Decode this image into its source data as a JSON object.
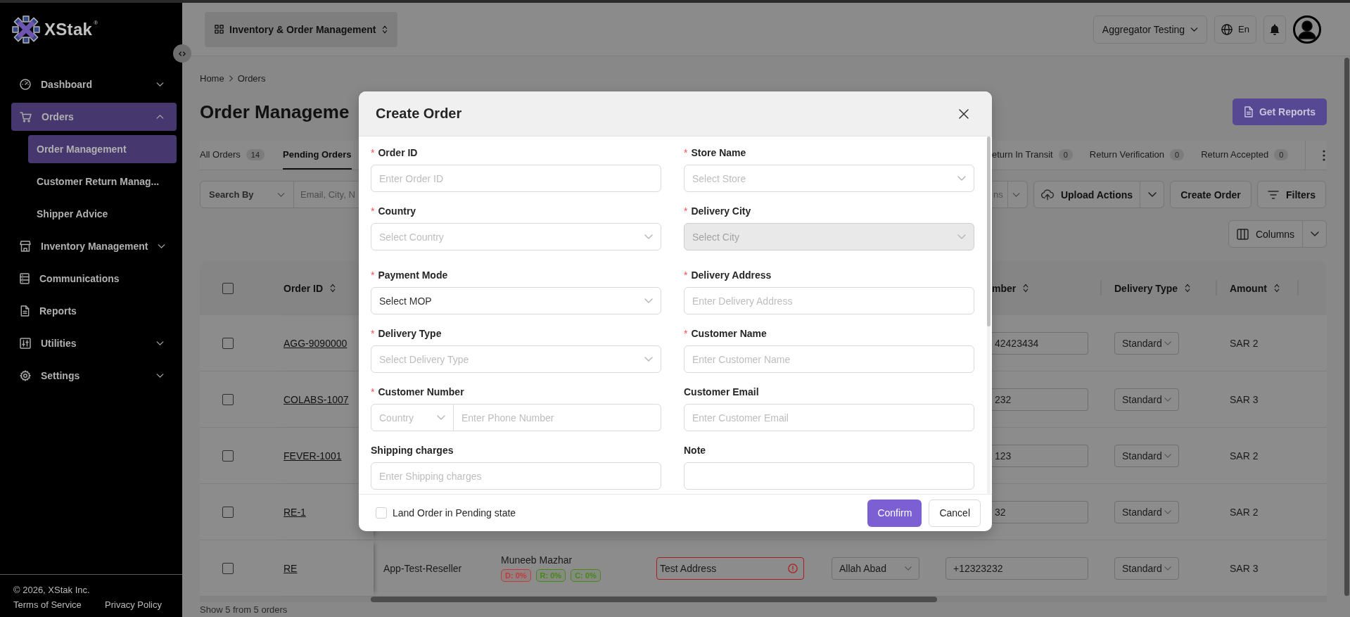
{
  "sidebar": {
    "logo": {
      "name": "XStak",
      "trademark": "®"
    },
    "items": [
      {
        "label": "Dashboard",
        "kind": "group",
        "expanded": false,
        "selected": false
      },
      {
        "label": "Orders",
        "kind": "group",
        "expanded": true,
        "selected": true,
        "children": [
          {
            "label": "Order Management",
            "selected": true
          },
          {
            "label": "Customer Return Manag...",
            "selected": false
          },
          {
            "label": "Shipper Advice",
            "selected": false
          }
        ]
      },
      {
        "label": "Inventory Management",
        "kind": "group",
        "expanded": false,
        "selected": false
      },
      {
        "label": "Communications",
        "kind": "link",
        "selected": false
      },
      {
        "label": "Reports",
        "kind": "link",
        "selected": false
      },
      {
        "label": "Utilities",
        "kind": "group",
        "expanded": false,
        "selected": false
      },
      {
        "label": "Settings",
        "kind": "group",
        "expanded": false,
        "selected": false
      }
    ],
    "footer": {
      "copyright": "© 2026, XStak Inc.",
      "links": [
        "Terms of Service",
        "Privacy Policy"
      ]
    }
  },
  "top_bar": {
    "app_switcher": "Inventory & Order Management",
    "account": "Aggregator Testing",
    "language": "En"
  },
  "page": {
    "breadcrumb": [
      "Home",
      "Orders"
    ],
    "title": "Order Manageme",
    "reports_button": "Get Reports",
    "tabs": [
      {
        "label": "All Orders",
        "count": "14",
        "selected": false
      },
      {
        "label": "Pending Orders",
        "selected": true
      },
      {
        "label": "eturn In Transit",
        "count": "0",
        "selected": false
      },
      {
        "label": "Return Verification",
        "count": "0",
        "selected": false
      },
      {
        "label": "Return Accepted",
        "count": "0",
        "selected": false
      }
    ],
    "toolbar": {
      "search_by": "Search By",
      "search_placeholder": "Email, City, N",
      "partial_select": "ns",
      "upload_button": "Upload Actions",
      "create_button": "Create Order",
      "filters_button": "Filters",
      "columns_button": "Columns"
    },
    "table": {
      "select_all_checked": false,
      "header": {
        "order_id": "Order ID",
        "number": "mber",
        "delivery_type": "Delivery Type",
        "amount": "Amount"
      },
      "rows": [
        {
          "checked": false,
          "order_id": "AGG-9090000",
          "number": "42423434",
          "delivery_type": "Standard",
          "amount": "SAR 2"
        },
        {
          "checked": false,
          "order_id": "COLABS-1007",
          "number": "232",
          "delivery_type": "Standard",
          "amount": "SAR 3"
        },
        {
          "checked": false,
          "order_id": "FEVER-1001",
          "number": "123",
          "delivery_type": "Standard",
          "amount": "SAR 2"
        },
        {
          "checked": false,
          "order_id": "RE-1",
          "number": "32",
          "delivery_type": "Standard",
          "amount": "SAR 2"
        },
        {
          "checked": false,
          "order_id": "RE",
          "store": "App-Test-Reseller",
          "customer": {
            "name": "Muneeb Mazhar",
            "tags": [
              {
                "label": "D: 0%",
                "color": "#c43a3a"
              },
              {
                "label": "R: 0%",
                "color": "#4a861c"
              },
              {
                "label": "C: 0%",
                "color": "#4a861c"
              }
            ]
          },
          "address": {
            "value": "Test Address",
            "error": true
          },
          "city": "Allah Abad",
          "number": "+12323232",
          "delivery_type": "Standard",
          "amount": "SAR 3"
        }
      ]
    },
    "summary": "Show 5 from 5 orders"
  },
  "modal": {
    "title": "Create Order",
    "fields": [
      {
        "label": "Order ID",
        "required_mark": "*",
        "kind": "input",
        "placeholder": "Enter Order ID",
        "disabled": false
      },
      {
        "label": "Store Name",
        "required_mark": "*",
        "kind": "select",
        "placeholder": "Select Store",
        "disabled": false
      },
      {
        "label": "Country",
        "required_mark": "*",
        "kind": "select",
        "placeholder": "Select Country",
        "disabled": false
      },
      {
        "label": "Delivery City",
        "required_mark": "*",
        "kind": "select",
        "placeholder": "Select City",
        "disabled": true
      },
      {
        "label": "Payment Mode",
        "required_mark": "*",
        "kind": "select",
        "value": "Select MOP",
        "disabled": false
      },
      {
        "label": "Delivery Address",
        "required_mark": "*",
        "kind": "input",
        "placeholder": "Enter Delivery Address",
        "disabled": false
      },
      {
        "label": "Delivery Type",
        "required_mark": "*",
        "kind": "select",
        "placeholder": "Select Delivery Type",
        "disabled": false
      },
      {
        "label": "Customer Name",
        "required_mark": "*",
        "kind": "input",
        "placeholder": "Enter Customer Name",
        "disabled": false
      },
      {
        "label": "Customer Number",
        "required_mark": "*",
        "kind": "phone",
        "code_placeholder": "Country",
        "placeholder": "Enter Phone Number",
        "disabled": false
      },
      {
        "label": "Customer Email",
        "kind": "input",
        "placeholder": "Enter Customer Email",
        "disabled": false
      },
      {
        "label": "Shipping charges",
        "kind": "input",
        "placeholder": "Enter Shipping charges",
        "disabled": false
      },
      {
        "label": "Note",
        "kind": "textarea",
        "disabled": false
      }
    ],
    "pending_checkbox": {
      "label": "Land Order in Pending state",
      "checked": false
    },
    "buttons": {
      "confirm": "Confirm",
      "cancel": "Cancel"
    }
  }
}
